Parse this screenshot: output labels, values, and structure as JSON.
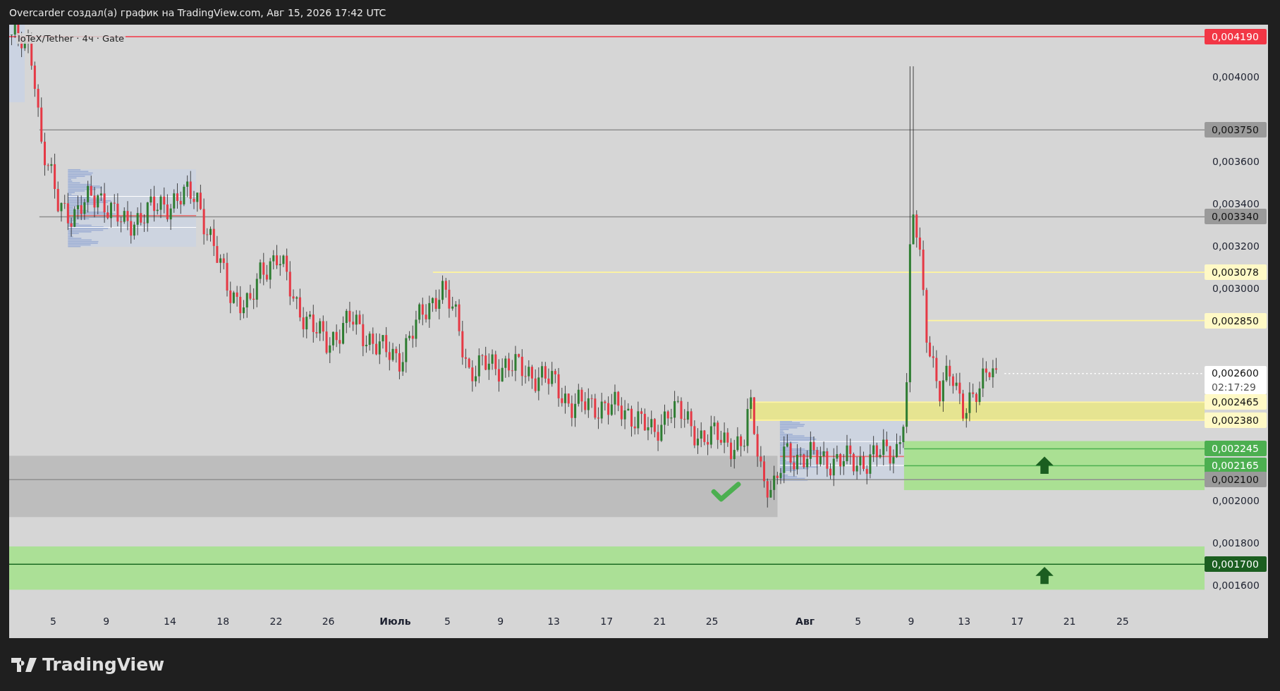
{
  "header": {
    "title": "Overcarder создал(а) график на TradingView.com, Авг 15, 2026 17:42 UTC"
  },
  "chart": {
    "legend": "IoTeX/Tether · 4ч · Gate"
  },
  "price_axis": {
    "ticks": [
      "0,004000",
      "0,003600",
      "0,003400",
      "0,003200",
      "0,003000",
      "0,002000",
      "0,001800",
      "0,001600"
    ],
    "marks": [
      {
        "text": "0,004190",
        "kind": "red"
      },
      {
        "text": "0,003750",
        "kind": "gray"
      },
      {
        "text": "0,003340",
        "kind": "gray"
      },
      {
        "text": "0,003078",
        "kind": "yellow"
      },
      {
        "text": "0,002850",
        "kind": "yellow"
      },
      {
        "text": "0,002600",
        "kind": "current",
        "countdown": "02:17:29"
      },
      {
        "text": "0,002465",
        "kind": "yellow"
      },
      {
        "text": "0,002380",
        "kind": "yellow"
      },
      {
        "text": "0,002245",
        "kind": "green"
      },
      {
        "text": "0,002165",
        "kind": "green"
      },
      {
        "text": "0,002100",
        "kind": "gray"
      },
      {
        "text": "0,001700",
        "kind": "darkgreen"
      }
    ]
  },
  "time_axis": {
    "labels": [
      {
        "text": "5",
        "bold": false
      },
      {
        "text": "9",
        "bold": false
      },
      {
        "text": "14",
        "bold": false
      },
      {
        "text": "18",
        "bold": false
      },
      {
        "text": "22",
        "bold": false
      },
      {
        "text": "26",
        "bold": false
      },
      {
        "text": "Июль",
        "bold": true
      },
      {
        "text": "5",
        "bold": false
      },
      {
        "text": "9",
        "bold": false
      },
      {
        "text": "13",
        "bold": false
      },
      {
        "text": "17",
        "bold": false
      },
      {
        "text": "21",
        "bold": false
      },
      {
        "text": "25",
        "bold": false
      },
      {
        "text": "Авг",
        "bold": true
      },
      {
        "text": "5",
        "bold": false
      },
      {
        "text": "9",
        "bold": false
      },
      {
        "text": "13",
        "bold": false
      },
      {
        "text": "17",
        "bold": false
      },
      {
        "text": "21",
        "bold": false
      },
      {
        "text": "25",
        "bold": false
      }
    ]
  },
  "brand": {
    "name": "TradingView"
  }
}
